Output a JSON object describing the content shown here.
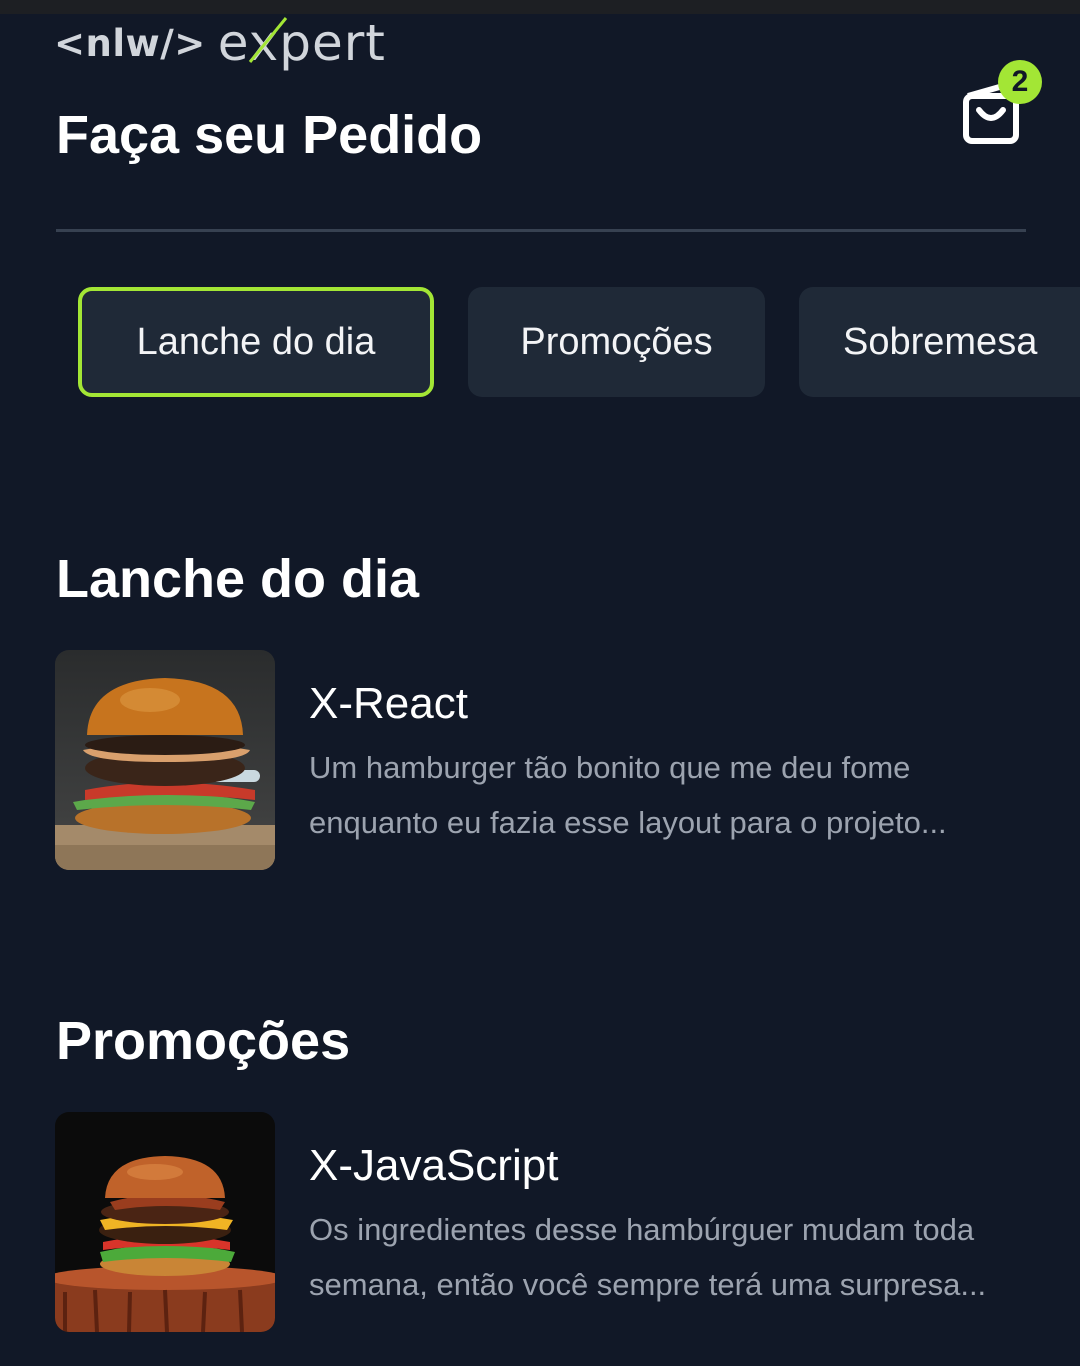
{
  "header": {
    "logo_text_left": "<nlw/>",
    "logo_text_right": "expert",
    "title": "Faça seu Pedido",
    "cart_count": "2"
  },
  "tabs": [
    {
      "label": "Lanche do dia",
      "active": true
    },
    {
      "label": "Promoções",
      "active": false
    },
    {
      "label": "Sobremesa",
      "active": false
    }
  ],
  "sections": [
    {
      "title": "Lanche do dia",
      "item": {
        "name": "X-React",
        "description": "Um hamburger tão bonito que me deu fome enquanto eu fazia esse layout para o projeto..."
      }
    },
    {
      "title": "Promoções",
      "item": {
        "name": "X-JavaScript",
        "description": "Os ingredientes desse hambúrguer mudam toda semana, então você sempre terá uma surpresa..."
      }
    }
  ],
  "colors": {
    "background": "#111827",
    "accent": "#a3e635",
    "tab_bg": "#1f2937",
    "muted_text": "#9ca3af"
  }
}
